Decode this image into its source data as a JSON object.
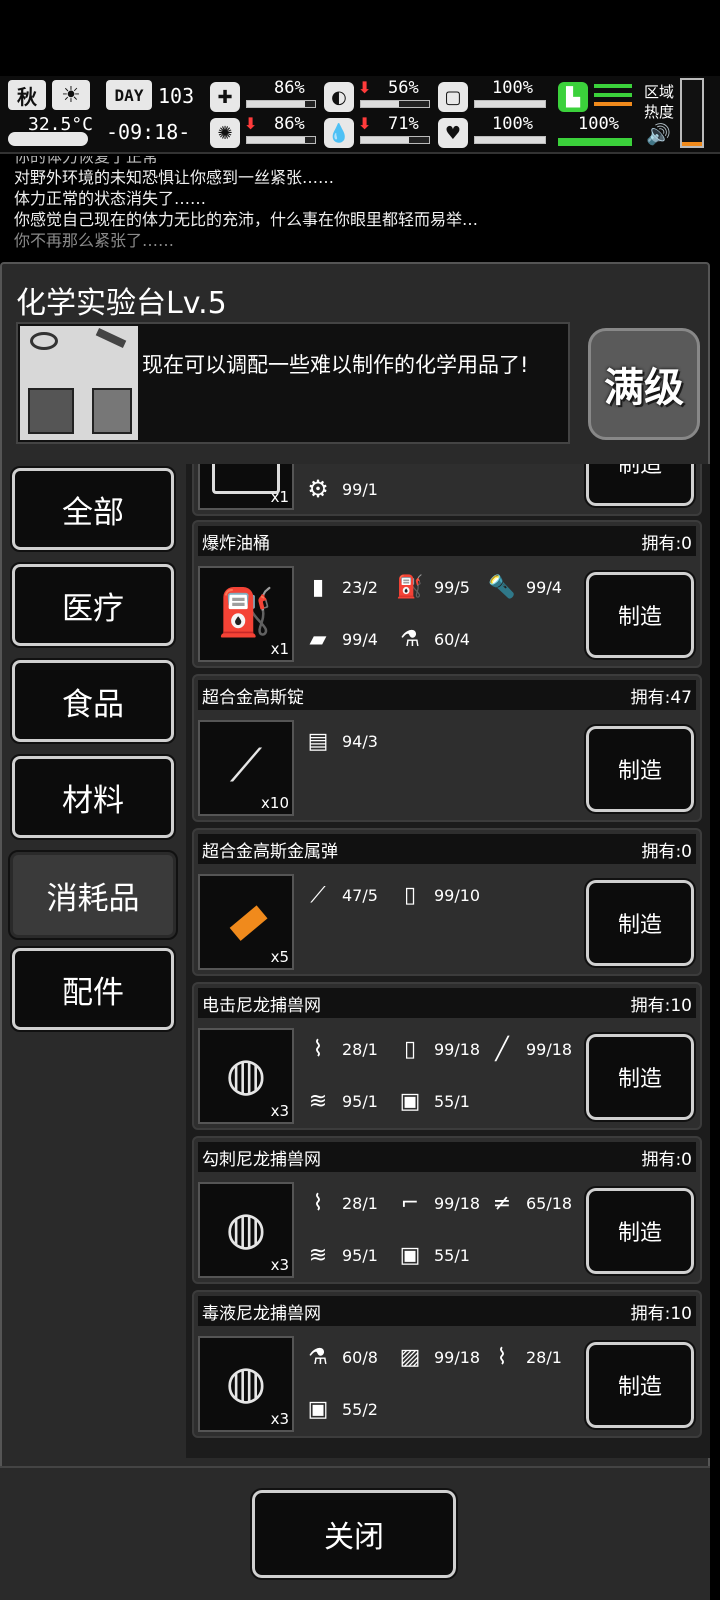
{
  "status": {
    "season": "秋",
    "temperature": "32.5°C",
    "day_label": "DAY",
    "day_number": "103",
    "time": "-09:18-",
    "health": {
      "value": "86%",
      "level": 0.86
    },
    "stomach": {
      "value": "56%",
      "level": 0.56
    },
    "water_tank": {
      "value": "100%",
      "level": 1.0
    },
    "mind": {
      "value": "86%",
      "level": 0.86
    },
    "thirst": {
      "value": "71%",
      "level": 0.71
    },
    "heart": {
      "value": "100%",
      "level": 1.0
    },
    "stamina": {
      "value": "100%",
      "level": 1.0
    },
    "region_heat_label": "区域热度"
  },
  "log": {
    "partial_line": "你的体力恢复了正常",
    "lines": [
      "对野外环境的未知恐惧让你感到一丝紧张……",
      "体力正常的状态消失了……",
      "你感觉自己现在的体力无比的充沛，什么事在你眼里都轻而易举…",
      "你不再那么紧张了……"
    ]
  },
  "panel": {
    "title": "化学实验台Lv.5",
    "description": "现在可以调配一些难以制作的化学用品了!",
    "max_level_badge": "满级"
  },
  "categories": [
    "全部",
    "医疗",
    "食品",
    "材料",
    "消耗品",
    "配件"
  ],
  "active_category": "消耗品",
  "make_label": "制造",
  "owned_prefix": "拥有:",
  "partial_recipe": {
    "qty": "x1",
    "ingredients": [
      {
        "icon": "gears-icon",
        "amount": "99/1"
      }
    ]
  },
  "recipes": [
    {
      "name": "爆炸油桶",
      "owned": "0",
      "qty": "x1",
      "icon": "oil-barrel-icon",
      "ingredients": [
        {
          "icon": "barrel-icon",
          "amount": "23/2"
        },
        {
          "icon": "fuel-can-icon",
          "amount": "99/5"
        },
        {
          "icon": "torch-icon",
          "amount": "99/4"
        },
        {
          "icon": "battery-pack-icon",
          "amount": "99/4"
        },
        {
          "icon": "flask-icon",
          "amount": "60/4"
        }
      ]
    },
    {
      "name": "超合金高斯锭",
      "owned": "47",
      "qty": "x10",
      "icon": "gauss-ingot-icon",
      "ingredients": [
        {
          "icon": "alloy-sheet-icon",
          "amount": "94/3"
        }
      ]
    },
    {
      "name": "超合金高斯金属弹",
      "owned": "0",
      "qty": "x5",
      "icon": "gauss-bullet-icon",
      "ingredients": [
        {
          "icon": "gauss-ingot-icon",
          "amount": "47/5"
        },
        {
          "icon": "battery-icon",
          "amount": "99/10"
        }
      ]
    },
    {
      "name": "电击尼龙捕兽网",
      "owned": "10",
      "qty": "x3",
      "icon": "shock-net-icon",
      "ingredients": [
        {
          "icon": "cloth-roll-icon",
          "amount": "28/1"
        },
        {
          "icon": "battery-icon",
          "amount": "99/18"
        },
        {
          "icon": "nail-icon",
          "amount": "99/18"
        },
        {
          "icon": "rope-icon",
          "amount": "95/1"
        },
        {
          "icon": "glue-bottle-icon",
          "amount": "55/1"
        }
      ]
    },
    {
      "name": "勾刺尼龙捕兽网",
      "owned": "0",
      "qty": "x3",
      "icon": "hook-net-icon",
      "ingredients": [
        {
          "icon": "cloth-roll-icon",
          "amount": "28/1"
        },
        {
          "icon": "pipe-icon",
          "amount": "99/18"
        },
        {
          "icon": "scrap-metal-icon",
          "amount": "65/18"
        },
        {
          "icon": "rope-icon",
          "amount": "95/1"
        },
        {
          "icon": "glue-bottle-icon",
          "amount": "55/1"
        }
      ]
    },
    {
      "name": "毒液尼龙捕兽网",
      "owned": "10",
      "qty": "x3",
      "icon": "venom-net-icon",
      "ingredients": [
        {
          "icon": "flask-icon",
          "amount": "60/8"
        },
        {
          "icon": "fertilizer-bag-icon",
          "amount": "99/18"
        },
        {
          "icon": "cloth-roll-icon",
          "amount": "28/1"
        },
        {
          "icon": "glue-bottle-icon",
          "amount": "55/2"
        }
      ]
    }
  ],
  "close_label": "关闭",
  "colors": {
    "bullet_orange": "#f08a1c",
    "stamina_green": "#3bd13b",
    "alert_red": "#ff3b3b"
  }
}
